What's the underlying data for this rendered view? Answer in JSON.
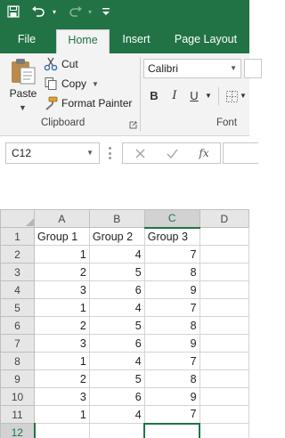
{
  "quick_access": {
    "save_icon": "save-icon",
    "undo_icon": "undo-icon",
    "redo_icon": "redo-icon",
    "customize_icon": "customize-qat-icon"
  },
  "ribbon_tabs": [
    {
      "label": "File",
      "active": false
    },
    {
      "label": "Home",
      "active": true
    },
    {
      "label": "Insert",
      "active": false
    },
    {
      "label": "Page Layout",
      "active": false
    }
  ],
  "clipboard": {
    "paste_label": "Paste",
    "cut_label": "Cut",
    "copy_label": "Copy",
    "format_painter_label": "Format Painter",
    "group_label": "Clipboard"
  },
  "font": {
    "font_name": "Calibri",
    "bold_label": "B",
    "italic_label": "I",
    "underline_label": "U",
    "group_label": "Font"
  },
  "formula_bar": {
    "name_box": "C12",
    "fx_label": "fx",
    "formula": ""
  },
  "sheet": {
    "columns": [
      "A",
      "B",
      "C",
      "D"
    ],
    "selected_column": "C",
    "selected_row": "12",
    "rows": [
      {
        "row": "1",
        "cells": [
          "Group 1",
          "Group 2",
          "Group 3",
          ""
        ]
      },
      {
        "row": "2",
        "cells": [
          "1",
          "4",
          "7",
          ""
        ]
      },
      {
        "row": "3",
        "cells": [
          "2",
          "5",
          "8",
          ""
        ]
      },
      {
        "row": "4",
        "cells": [
          "3",
          "6",
          "9",
          ""
        ]
      },
      {
        "row": "5",
        "cells": [
          "1",
          "4",
          "7",
          ""
        ]
      },
      {
        "row": "6",
        "cells": [
          "2",
          "5",
          "8",
          ""
        ]
      },
      {
        "row": "7",
        "cells": [
          "3",
          "6",
          "9",
          ""
        ]
      },
      {
        "row": "8",
        "cells": [
          "1",
          "4",
          "7",
          ""
        ]
      },
      {
        "row": "9",
        "cells": [
          "2",
          "5",
          "8",
          ""
        ]
      },
      {
        "row": "10",
        "cells": [
          "3",
          "6",
          "9",
          ""
        ]
      },
      {
        "row": "11",
        "cells": [
          "1",
          "4",
          "7",
          ""
        ]
      },
      {
        "row": "12",
        "cells": [
          "",
          "",
          "",
          ""
        ]
      }
    ]
  },
  "colors": {
    "accent": "#217346",
    "ribbon_bg": "#f3f3f3",
    "header_bg": "#e6e6e6"
  }
}
